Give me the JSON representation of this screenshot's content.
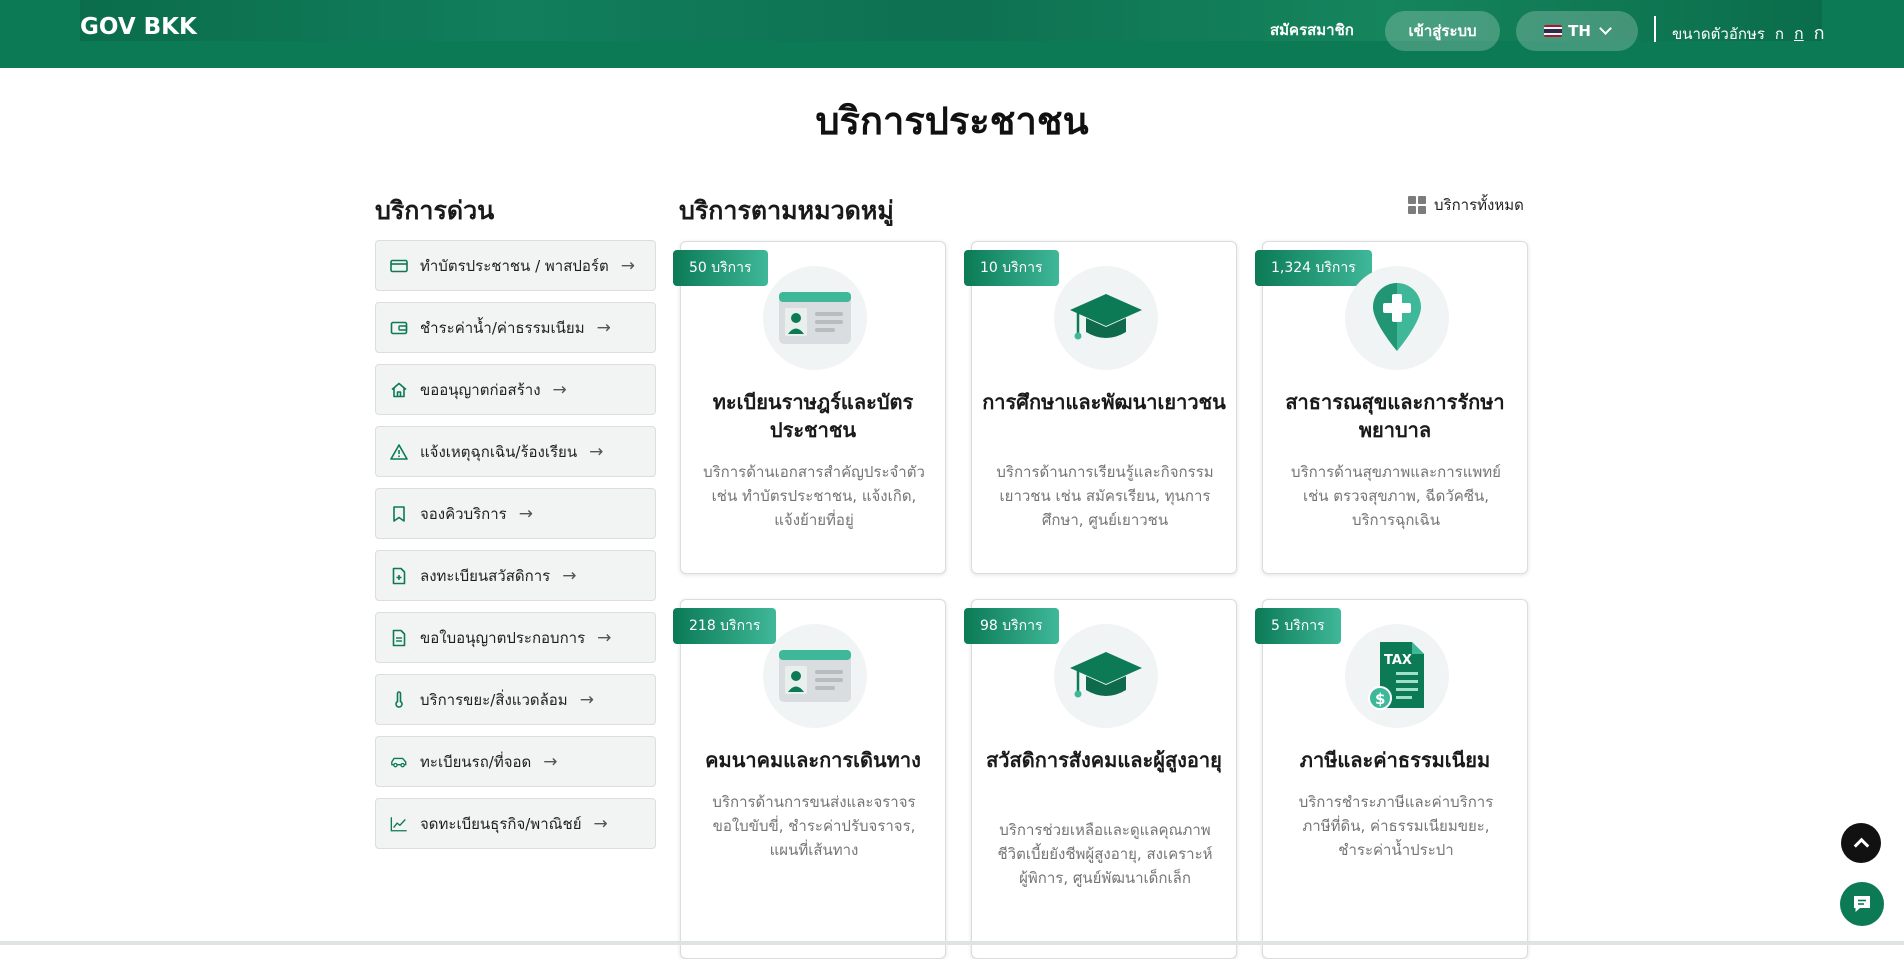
{
  "header": {
    "logo": "GOV BKK",
    "register": "สมัครสมาชิก",
    "login": "เข้าสู่ระบบ",
    "language": "TH",
    "font_size_label": "ขนาดตัวอักษร",
    "font_small": "ก",
    "font_medium": "ก",
    "font_large": "ก"
  },
  "page_title": "บริการประชาชน",
  "quick_services": {
    "title": "บริการด่วน",
    "items": [
      {
        "label": "ทำบัตรประชาชน / พาสปอร์ต",
        "icon": "credit-card-icon"
      },
      {
        "label": "ชำระค่าน้ำ/ค่าธรรมเนียม",
        "icon": "wallet-icon"
      },
      {
        "label": "ขออนุญาตก่อสร้าง",
        "icon": "home-icon"
      },
      {
        "label": "แจ้งเหตุฉุกเฉิน/ร้องเรียน",
        "icon": "warning-icon"
      },
      {
        "label": "จองคิวบริการ",
        "icon": "bookmark-icon"
      },
      {
        "label": "ลงทะเบียนสวัสดิการ",
        "icon": "file-plus-icon"
      },
      {
        "label": "ขอใบอนุญาตประกอบการ",
        "icon": "document-icon"
      },
      {
        "label": "บริการขยะ/สิ่งแวดล้อม",
        "icon": "thermometer-icon"
      },
      {
        "label": "ทะเบียนรถ/ที่จอด",
        "icon": "car-icon"
      },
      {
        "label": "จดทะเบียนธุรกิจ/พาณิชย์",
        "icon": "chart-line-icon"
      }
    ],
    "arrow": "→"
  },
  "categories": {
    "title": "บริการตามหมวดหมู่",
    "all_label": "บริการทั้งหมด",
    "cards": [
      {
        "badge": "50 บริการ",
        "title": "ทะเบียนราษฎร์และบัตรประชาชน",
        "desc": "บริการด้านเอกสารสำคัญประจำตัว เช่น ทำบัตรประชาชน, แจ้งเกิด, แจ้งย้ายที่อยู่",
        "icon": "id-card-icon"
      },
      {
        "badge": "10 บริการ",
        "title": "การศึกษาและพัฒนาเยาวชน",
        "desc": "บริการด้านการเรียนรู้และกิจกรรมเยาวชน เช่น สมัครเรียน, ทุนการศึกษา, ศูนย์เยาวชน",
        "icon": "graduation-cap-icon"
      },
      {
        "badge": "1,324 บริการ",
        "title": "สาธารณสุขและการรักษาพยาบาล",
        "desc": "บริการด้านสุขภาพและการแพทย์ เช่น ตรวจสุขภาพ, ฉีดวัคซีน, บริการฉุกเฉิน",
        "icon": "health-pin-icon"
      },
      {
        "badge": "218 บริการ",
        "title": "คมนาคมและการเดินทาง",
        "desc": "บริการด้านการขนส่งและจราจร ขอใบขับขี่, ชำระค่าปรับจราจร, แผนที่เส้นทาง",
        "icon": "id-card-icon"
      },
      {
        "badge": "98 บริการ",
        "title": "สวัสดิการสังคมและผู้สูงอายุ",
        "desc": "บริการช่วยเหลือและดูแลคุณภาพชีวิตเบี้ยยังชีพผู้สูงอายุ, สงเคราะห์ผู้พิการ, ศูนย์พัฒนาเด็กเล็ก",
        "icon": "graduation-cap-icon"
      },
      {
        "badge": "5 บริการ",
        "title": "ภาษีและค่าธรรมเนียม",
        "desc": "บริการชำระภาษีและค่าบริการ ภาษีที่ดิน, ค่าธรรมเนียมขยะ, ชำระค่าน้ำประปา",
        "icon": "tax-document-icon"
      }
    ]
  },
  "colors": {
    "brand": "#0b7a55",
    "badge_end": "#3fb899"
  }
}
